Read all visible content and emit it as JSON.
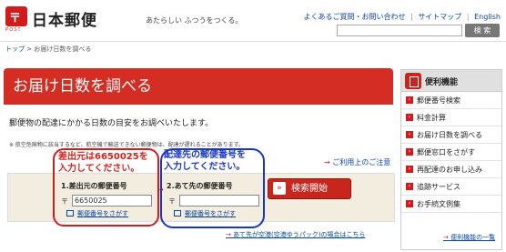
{
  "header": {
    "logo_text": "〒",
    "logo_sub": "POST",
    "brand": "日本郵便",
    "tagline": "あたらしい ふつうをつくる。",
    "links": [
      "よくあるご質問・お問い合わせ",
      "サイトマップ",
      "English"
    ],
    "separator": "|",
    "search_placeholder": "",
    "search_button": "検 索"
  },
  "breadcrumb": {
    "home": "トップ",
    "arrow": ">",
    "current": "お届け日数を調べる"
  },
  "page": {
    "title": "お届け日数を調べる",
    "intro": "郵便物の配達にかかる日数の目安をお調べいたします。",
    "note": "※ 航空危険物に該当するなど、航空機で輸送できない郵便物は、配達が遅れることがあります。",
    "usage_link": "ご利用上のご注意",
    "link_arrow": "→"
  },
  "form": {
    "from_label": "1.差出元の郵便番号",
    "to_label": "2.あて先の郵便番号",
    "postal_mark": "〒",
    "from_value": "6650025",
    "to_value": "",
    "lookup_label": "郵便番号をさがす",
    "mid_arrow": "→",
    "submit_label": "検索開始",
    "submit_chevron": "»"
  },
  "annotations": {
    "red_line1": "差出元は6650025を",
    "red_line2": "入力してください。",
    "blue_line1": "配達先の郵便番号を",
    "blue_line2": "入力してください。"
  },
  "footer_link": "あて先が空港(空港ゆうパック)の場合はこちら",
  "sidebar": {
    "title": "便利機能",
    "chevron": "›",
    "items": [
      "郵便番号検索",
      "料金計算",
      "お届け日数を調べる",
      "郵便窓口をさがす",
      "再配達のお申し込み",
      "追跡サービス",
      "お手続文例集"
    ],
    "more": "便利機能の一覧"
  },
  "colors": {
    "brand_red": "#d21c1c",
    "annotation_red": "#e0201a",
    "annotation_blue": "#1a36c9",
    "form_bg": "#f2eddf"
  },
  "icons": {
    "logo": "japan-post-logo-icon",
    "lookup": "book-icon",
    "sidebar": "tools-icon"
  }
}
